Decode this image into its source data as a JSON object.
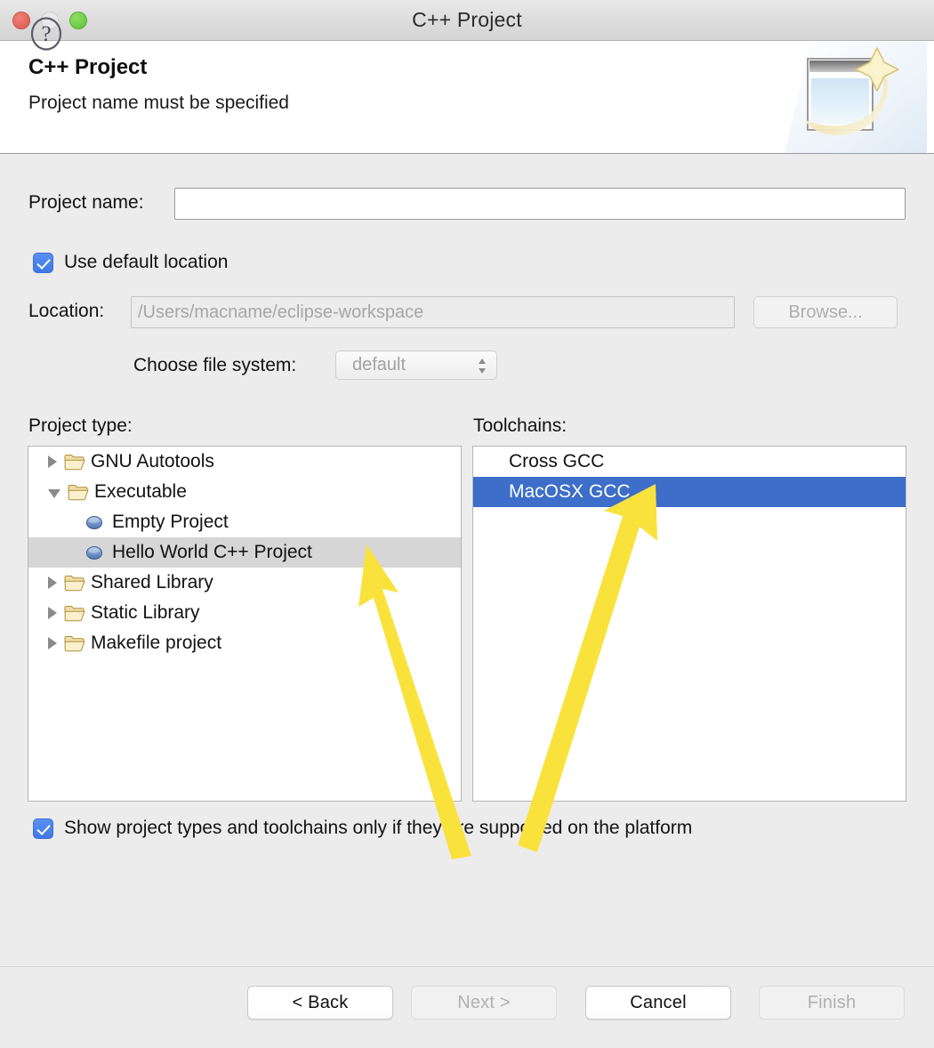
{
  "window": {
    "title": "C++ Project",
    "traffic_lights": [
      "close-button",
      "minimize-button",
      "zoom-button"
    ]
  },
  "header": {
    "title": "C++ Project",
    "subtitle": "Project name must be specified",
    "icon": "new-project-wizard-banner-icon"
  },
  "form": {
    "project_name_label": "Project name:",
    "project_name_value": "",
    "project_name_placeholder": "",
    "use_default_location_label": "Use default location",
    "use_default_location_checked": true,
    "location_label": "Location:",
    "location_value": "",
    "location_placeholder": "/Users/macname/eclipse-workspace",
    "location_enabled": false,
    "browse_label": "Browse...",
    "browse_enabled": false,
    "filesystem_label": "Choose file system:",
    "filesystem_value": "default",
    "filesystem_enabled": false
  },
  "project_type": {
    "label": "Project type:",
    "items": [
      {
        "label": "GNU Autotools",
        "kind": "folder",
        "state": "collapsed",
        "depth": 0,
        "selected": false
      },
      {
        "label": "Executable",
        "kind": "folder",
        "state": "expanded",
        "depth": 0,
        "selected": false
      },
      {
        "label": "Empty Project",
        "kind": "leaf",
        "state": "none",
        "depth": 1,
        "selected": false
      },
      {
        "label": "Hello World C++ Project",
        "kind": "leaf",
        "state": "none",
        "depth": 1,
        "selected": true
      },
      {
        "label": "Shared Library",
        "kind": "folder",
        "state": "collapsed",
        "depth": 0,
        "selected": false
      },
      {
        "label": "Static Library",
        "kind": "folder",
        "state": "collapsed",
        "depth": 0,
        "selected": false
      },
      {
        "label": "Makefile project",
        "kind": "folder",
        "state": "collapsed",
        "depth": 0,
        "selected": false
      }
    ]
  },
  "toolchains": {
    "label": "Toolchains:",
    "items": [
      {
        "label": "Cross GCC",
        "selected": false
      },
      {
        "label": "MacOSX GCC",
        "selected": true
      }
    ]
  },
  "platform_filter": {
    "label": "Show project types and toolchains only if they are supported on the platform",
    "checked": true
  },
  "footer": {
    "help_label": "?",
    "buttons": [
      {
        "label": "< Back",
        "enabled": true
      },
      {
        "label": "Next >",
        "enabled": false
      },
      {
        "label": "Cancel",
        "enabled": true
      },
      {
        "label": "Finish",
        "enabled": false
      }
    ]
  },
  "annotations": {
    "arrow_color": "#FAE23C",
    "arrows": [
      {
        "name": "arrow-to-hello-world-project",
        "points_to": "Hello World C++ Project"
      },
      {
        "name": "arrow-to-macosx-gcc",
        "points_to": "MacOSX GCC"
      }
    ]
  },
  "colors": {
    "selection_active": "#3d6ec9",
    "selection_inactive": "#d6d6d6",
    "checkbox_blue": "#4a7fe8",
    "body_background": "#ececec",
    "arrow_yellow": "#FAE23C"
  }
}
